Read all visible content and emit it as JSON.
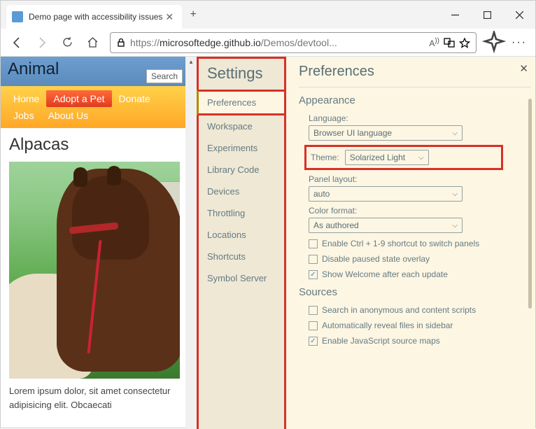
{
  "window": {
    "tab_title": "Demo page with accessibility issues",
    "url_pre": "https://",
    "url_main": "microsoftedge.github.io",
    "url_post": "/Demos/devtool..."
  },
  "webpage": {
    "brand": "Animal",
    "search_placeholder": "Search",
    "nav": [
      "Home",
      "Adopt a Pet",
      "Donate",
      "Jobs",
      "About Us"
    ],
    "heading": "Alpacas",
    "description": "Lorem ipsum dolor, sit amet consectetur adipisicing elit. Obcaecati"
  },
  "devtools": {
    "sidebar_title": "Settings",
    "sidebar_items": [
      "Preferences",
      "Workspace",
      "Experiments",
      "Library Code",
      "Devices",
      "Throttling",
      "Locations",
      "Shortcuts",
      "Symbol Server"
    ],
    "prefs_title": "Preferences",
    "appearance": {
      "title": "Appearance",
      "language_label": "Language:",
      "language_value": "Browser UI language",
      "theme_label": "Theme:",
      "theme_value": "Solarized Light",
      "layout_label": "Panel layout:",
      "layout_value": "auto",
      "color_label": "Color format:",
      "color_value": "As authored",
      "chk1": "Enable Ctrl + 1-9 shortcut to switch panels",
      "chk2": "Disable paused state overlay",
      "chk3": "Show Welcome after each update"
    },
    "sources": {
      "title": "Sources",
      "chk1": "Search in anonymous and content scripts",
      "chk2": "Automatically reveal files in sidebar",
      "chk3": "Enable JavaScript source maps"
    }
  }
}
